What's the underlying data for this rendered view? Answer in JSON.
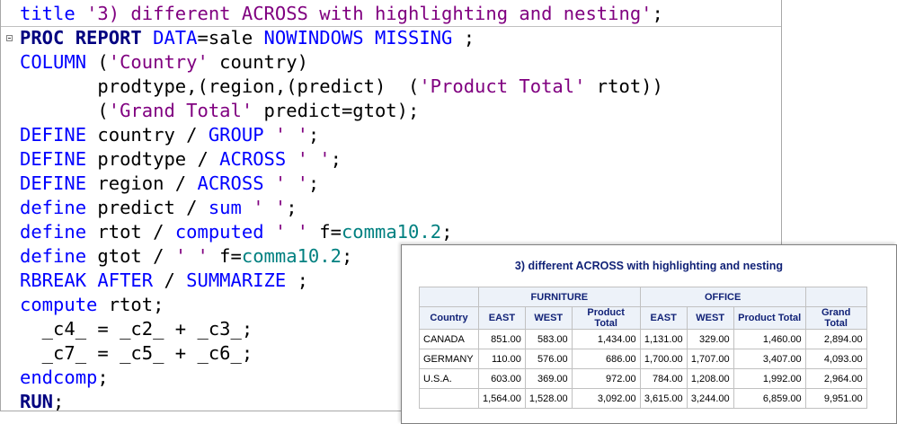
{
  "editor": {
    "lines": [
      [
        {
          "t": "title ",
          "c": "kw"
        },
        {
          "t": "'3) different ACROSS with highlighting and nesting'",
          "c": "str"
        },
        {
          "t": ";",
          "c": "plain"
        }
      ],
      [
        {
          "t": "PROC REPORT ",
          "c": "kwb"
        },
        {
          "t": "DATA",
          "c": "kw"
        },
        {
          "t": "=sale ",
          "c": "plain"
        },
        {
          "t": "NOWINDOWS MISSING",
          "c": "kw"
        },
        {
          "t": " ;",
          "c": "plain"
        }
      ],
      [
        {
          "t": "COLUMN ",
          "c": "kw"
        },
        {
          "t": "(",
          "c": "plain"
        },
        {
          "t": "'Country'",
          "c": "str"
        },
        {
          "t": " country)",
          "c": "plain"
        }
      ],
      [
        {
          "t": "       prodtype,(region,(predict)  (",
          "c": "plain"
        },
        {
          "t": "'Product Total'",
          "c": "str"
        },
        {
          "t": " rtot))",
          "c": "plain"
        }
      ],
      [
        {
          "t": "       (",
          "c": "plain"
        },
        {
          "t": "'Grand Total'",
          "c": "str"
        },
        {
          "t": " predict=gtot);",
          "c": "plain"
        }
      ],
      [
        {
          "t": "DEFINE",
          "c": "kw"
        },
        {
          "t": " country / ",
          "c": "plain"
        },
        {
          "t": "GROUP",
          "c": "kw"
        },
        {
          "t": " ",
          "c": "plain"
        },
        {
          "t": "' '",
          "c": "str"
        },
        {
          "t": ";",
          "c": "plain"
        }
      ],
      [
        {
          "t": "DEFINE",
          "c": "kw"
        },
        {
          "t": " prodtype / ",
          "c": "plain"
        },
        {
          "t": "ACROSS",
          "c": "kw"
        },
        {
          "t": " ",
          "c": "plain"
        },
        {
          "t": "' '",
          "c": "str"
        },
        {
          "t": ";",
          "c": "plain"
        }
      ],
      [
        {
          "t": "DEFINE",
          "c": "kw"
        },
        {
          "t": " region / ",
          "c": "plain"
        },
        {
          "t": "ACROSS",
          "c": "kw"
        },
        {
          "t": " ",
          "c": "plain"
        },
        {
          "t": "' '",
          "c": "str"
        },
        {
          "t": ";",
          "c": "plain"
        }
      ],
      [
        {
          "t": "define",
          "c": "kw"
        },
        {
          "t": " predict / ",
          "c": "plain"
        },
        {
          "t": "sum",
          "c": "kw"
        },
        {
          "t": " ",
          "c": "plain"
        },
        {
          "t": "' '",
          "c": "str"
        },
        {
          "t": ";",
          "c": "plain"
        }
      ],
      [
        {
          "t": "define",
          "c": "kw"
        },
        {
          "t": " rtot / ",
          "c": "plain"
        },
        {
          "t": "computed",
          "c": "kw"
        },
        {
          "t": " ",
          "c": "plain"
        },
        {
          "t": "' '",
          "c": "str"
        },
        {
          "t": " f=",
          "c": "plain"
        },
        {
          "t": "comma10.2",
          "c": "fmt"
        },
        {
          "t": ";",
          "c": "plain"
        }
      ],
      [
        {
          "t": "define",
          "c": "kw"
        },
        {
          "t": " gtot / ",
          "c": "plain"
        },
        {
          "t": "' '",
          "c": "str"
        },
        {
          "t": " f=",
          "c": "plain"
        },
        {
          "t": "comma10.2",
          "c": "fmt"
        },
        {
          "t": ";",
          "c": "plain"
        }
      ],
      [
        {
          "t": "RBREAK AFTER",
          "c": "kw"
        },
        {
          "t": " / ",
          "c": "plain"
        },
        {
          "t": "SUMMARIZE",
          "c": "kw"
        },
        {
          "t": " ;",
          "c": "plain"
        }
      ],
      [
        {
          "t": "compute",
          "c": "kw"
        },
        {
          "t": " rtot;",
          "c": "plain"
        }
      ],
      [
        {
          "t": "  _c4_ = _c2_ + _c3_;",
          "c": "plain"
        }
      ],
      [
        {
          "t": "  _c7_ = _c5_ + _c6_;",
          "c": "plain"
        }
      ],
      [
        {
          "t": "endcomp",
          "c": "kw"
        },
        {
          "t": ";",
          "c": "plain"
        }
      ],
      [
        {
          "t": "RUN",
          "c": "kwb"
        },
        {
          "t": ";",
          "c": "plain"
        }
      ]
    ]
  },
  "colors": {
    "keyword": "#0000ff",
    "keyword_bold": "#000080",
    "string": "#800080",
    "format": "#008080",
    "header_bg": "#edf2f9",
    "header_text": "#112277",
    "grid": "#c1c1c1"
  },
  "output": {
    "title": "3) different ACROSS with highlighting and nesting",
    "groups": [
      "FURNITURE",
      "OFFICE"
    ],
    "columns": [
      "Country",
      "EAST",
      "WEST",
      "Product Total",
      "EAST",
      "WEST",
      "Product Total",
      "Grand Total"
    ],
    "rows": [
      [
        "CANADA",
        "851.00",
        "583.00",
        "1,434.00",
        "1,131.00",
        "329.00",
        "1,460.00",
        "2,894.00"
      ],
      [
        "GERMANY",
        "110.00",
        "576.00",
        "686.00",
        "1,700.00",
        "1,707.00",
        "3,407.00",
        "4,093.00"
      ],
      [
        "U.S.A.",
        "603.00",
        "369.00",
        "972.00",
        "784.00",
        "1,208.00",
        "1,992.00",
        "2,964.00"
      ],
      [
        "",
        "1,564.00",
        "1,528.00",
        "3,092.00",
        "3,615.00",
        "3,244.00",
        "6,859.00",
        "9,951.00"
      ]
    ]
  }
}
